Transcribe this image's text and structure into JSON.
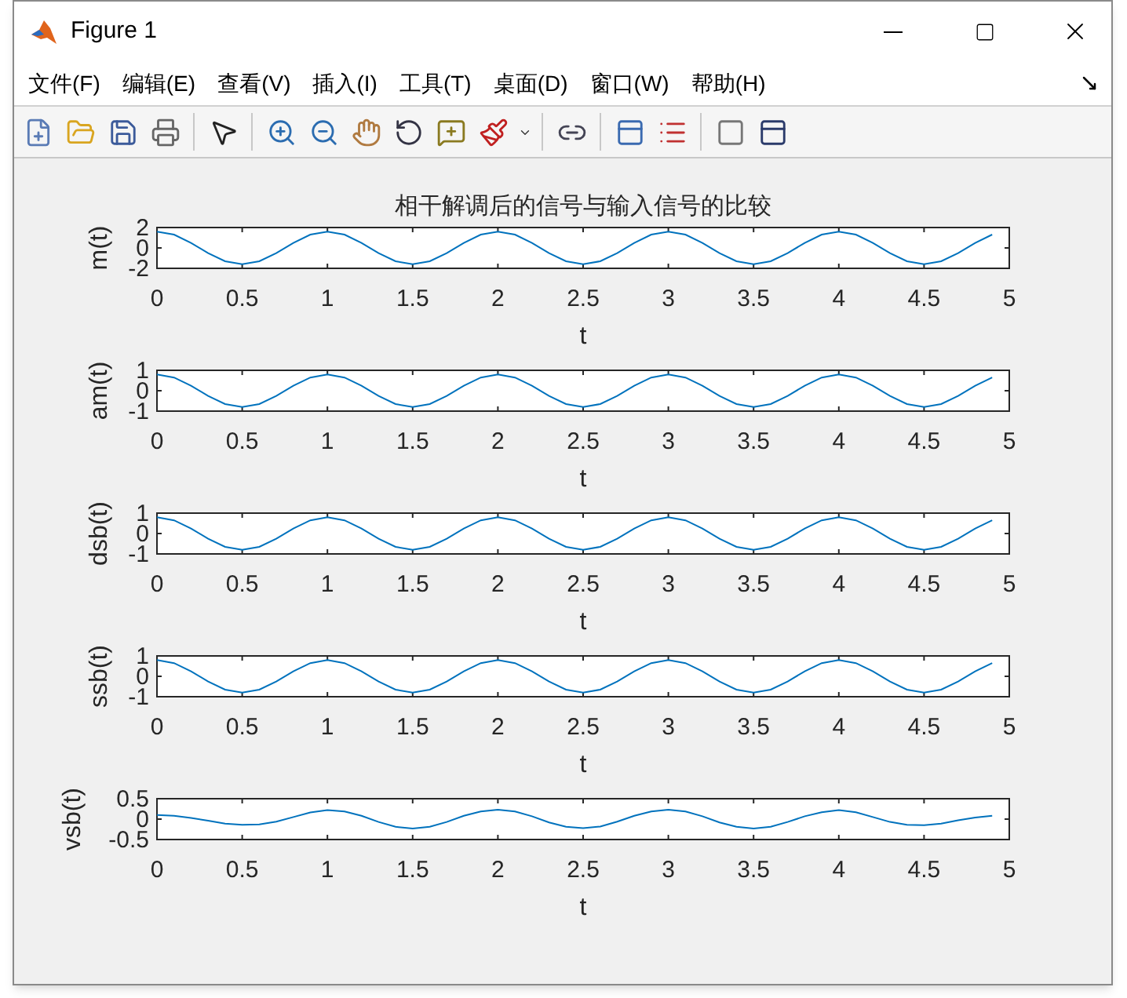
{
  "window": {
    "title": "Figure 1"
  },
  "menu": [
    "文件(F)",
    "编辑(E)",
    "查看(V)",
    "插入(I)",
    "工具(T)",
    "桌面(D)",
    "窗口(W)",
    "帮助(H)"
  ],
  "subplots": [
    {
      "chart_data": {
        "type": "line",
        "title": "相干解调后的信号与输入信号的比较",
        "xlabel": "t",
        "ylabel": "m(t)",
        "x": [
          0,
          0.1,
          0.2,
          0.3,
          0.4,
          0.5,
          0.6,
          0.7,
          0.8,
          0.9,
          1,
          1.1,
          1.2,
          1.3,
          1.4,
          1.5,
          1.6,
          1.7,
          1.8,
          1.9,
          2,
          2.1,
          2.2,
          2.3,
          2.4,
          2.5,
          2.6,
          2.7,
          2.8,
          2.9,
          3,
          3.1,
          3.2,
          3.3,
          3.4,
          3.5,
          3.6,
          3.7,
          3.8,
          3.9,
          4,
          4.1,
          4.2,
          4.3,
          4.4,
          4.5,
          4.6,
          4.7,
          4.8,
          4.9
        ],
        "series": [
          {
            "color": "#0072bd",
            "values": [
              1.6,
              1.3,
              0.5,
              -0.5,
              -1.3,
              -1.6,
              -1.3,
              -0.5,
              0.5,
              1.3,
              1.6,
              1.3,
              0.5,
              -0.5,
              -1.3,
              -1.6,
              -1.3,
              -0.5,
              0.5,
              1.3,
              1.6,
              1.3,
              0.5,
              -0.5,
              -1.3,
              -1.6,
              -1.3,
              -0.5,
              0.5,
              1.3,
              1.6,
              1.3,
              0.5,
              -0.5,
              -1.3,
              -1.6,
              -1.3,
              -0.5,
              0.5,
              1.3,
              1.6,
              1.3,
              0.5,
              -0.5,
              -1.3,
              -1.6,
              -1.3,
              -0.5,
              0.5,
              1.3
            ]
          }
        ],
        "xlim": [
          0,
          5
        ],
        "ylim": [
          -2,
          2
        ],
        "xticks": [
          0,
          0.5,
          1,
          1.5,
          2,
          2.5,
          3,
          3.5,
          4,
          4.5,
          5
        ],
        "yticks": [
          -2,
          0,
          2
        ]
      }
    },
    {
      "chart_data": {
        "type": "line",
        "xlabel": "t",
        "ylabel": "am(t)",
        "x": [
          0,
          0.1,
          0.2,
          0.3,
          0.4,
          0.5,
          0.6,
          0.7,
          0.8,
          0.9,
          1,
          1.1,
          1.2,
          1.3,
          1.4,
          1.5,
          1.6,
          1.7,
          1.8,
          1.9,
          2,
          2.1,
          2.2,
          2.3,
          2.4,
          2.5,
          2.6,
          2.7,
          2.8,
          2.9,
          3,
          3.1,
          3.2,
          3.3,
          3.4,
          3.5,
          3.6,
          3.7,
          3.8,
          3.9,
          4,
          4.1,
          4.2,
          4.3,
          4.4,
          4.5,
          4.6,
          4.7,
          4.8,
          4.9
        ],
        "series": [
          {
            "color": "#0072bd",
            "values": [
              0.8,
              0.65,
              0.25,
              -0.25,
              -0.65,
              -0.8,
              -0.65,
              -0.25,
              0.25,
              0.65,
              0.8,
              0.65,
              0.25,
              -0.25,
              -0.65,
              -0.8,
              -0.65,
              -0.25,
              0.25,
              0.65,
              0.8,
              0.65,
              0.25,
              -0.25,
              -0.65,
              -0.8,
              -0.65,
              -0.25,
              0.25,
              0.65,
              0.8,
              0.65,
              0.25,
              -0.25,
              -0.65,
              -0.8,
              -0.65,
              -0.25,
              0.25,
              0.65,
              0.8,
              0.65,
              0.25,
              -0.25,
              -0.65,
              -0.8,
              -0.65,
              -0.25,
              0.25,
              0.65
            ]
          }
        ],
        "xlim": [
          0,
          5
        ],
        "ylim": [
          -1,
          1
        ],
        "xticks": [
          0,
          0.5,
          1,
          1.5,
          2,
          2.5,
          3,
          3.5,
          4,
          4.5,
          5
        ],
        "yticks": [
          -1,
          0,
          1
        ]
      }
    },
    {
      "chart_data": {
        "type": "line",
        "xlabel": "t",
        "ylabel": "dsb(t)",
        "x": [
          0,
          0.1,
          0.2,
          0.3,
          0.4,
          0.5,
          0.6,
          0.7,
          0.8,
          0.9,
          1,
          1.1,
          1.2,
          1.3,
          1.4,
          1.5,
          1.6,
          1.7,
          1.8,
          1.9,
          2,
          2.1,
          2.2,
          2.3,
          2.4,
          2.5,
          2.6,
          2.7,
          2.8,
          2.9,
          3,
          3.1,
          3.2,
          3.3,
          3.4,
          3.5,
          3.6,
          3.7,
          3.8,
          3.9,
          4,
          4.1,
          4.2,
          4.3,
          4.4,
          4.5,
          4.6,
          4.7,
          4.8,
          4.9
        ],
        "series": [
          {
            "color": "#0072bd",
            "values": [
              0.8,
              0.65,
              0.25,
              -0.25,
              -0.65,
              -0.8,
              -0.65,
              -0.25,
              0.25,
              0.65,
              0.8,
              0.65,
              0.25,
              -0.25,
              -0.65,
              -0.8,
              -0.65,
              -0.25,
              0.25,
              0.65,
              0.8,
              0.65,
              0.25,
              -0.25,
              -0.65,
              -0.8,
              -0.65,
              -0.25,
              0.25,
              0.65,
              0.8,
              0.65,
              0.25,
              -0.25,
              -0.65,
              -0.8,
              -0.65,
              -0.25,
              0.25,
              0.65,
              0.8,
              0.65,
              0.25,
              -0.25,
              -0.65,
              -0.8,
              -0.65,
              -0.25,
              0.25,
              0.65
            ]
          }
        ],
        "xlim": [
          0,
          5
        ],
        "ylim": [
          -1,
          1
        ],
        "xticks": [
          0,
          0.5,
          1,
          1.5,
          2,
          2.5,
          3,
          3.5,
          4,
          4.5,
          5
        ],
        "yticks": [
          -1,
          0,
          1
        ]
      }
    },
    {
      "chart_data": {
        "type": "line",
        "xlabel": "t",
        "ylabel": "ssb(t)",
        "x": [
          0,
          0.1,
          0.2,
          0.3,
          0.4,
          0.5,
          0.6,
          0.7,
          0.8,
          0.9,
          1,
          1.1,
          1.2,
          1.3,
          1.4,
          1.5,
          1.6,
          1.7,
          1.8,
          1.9,
          2,
          2.1,
          2.2,
          2.3,
          2.4,
          2.5,
          2.6,
          2.7,
          2.8,
          2.9,
          3,
          3.1,
          3.2,
          3.3,
          3.4,
          3.5,
          3.6,
          3.7,
          3.8,
          3.9,
          4,
          4.1,
          4.2,
          4.3,
          4.4,
          4.5,
          4.6,
          4.7,
          4.8,
          4.9
        ],
        "series": [
          {
            "color": "#0072bd",
            "values": [
              0.8,
              0.65,
              0.25,
              -0.25,
              -0.65,
              -0.8,
              -0.65,
              -0.25,
              0.25,
              0.65,
              0.8,
              0.65,
              0.25,
              -0.25,
              -0.65,
              -0.8,
              -0.65,
              -0.25,
              0.25,
              0.65,
              0.8,
              0.65,
              0.25,
              -0.25,
              -0.65,
              -0.8,
              -0.65,
              -0.25,
              0.25,
              0.65,
              0.8,
              0.65,
              0.25,
              -0.25,
              -0.65,
              -0.8,
              -0.65,
              -0.25,
              0.25,
              0.65,
              0.8,
              0.65,
              0.25,
              -0.25,
              -0.65,
              -0.8,
              -0.65,
              -0.25,
              0.25,
              0.65
            ]
          }
        ],
        "xlim": [
          0,
          5
        ],
        "ylim": [
          -1,
          1
        ],
        "xticks": [
          0,
          0.5,
          1,
          1.5,
          2,
          2.5,
          3,
          3.5,
          4,
          4.5,
          5
        ],
        "yticks": [
          -1,
          0,
          1
        ]
      }
    },
    {
      "chart_data": {
        "type": "line",
        "xlabel": "t",
        "ylabel": "vsb(t)",
        "x": [
          0,
          0.1,
          0.2,
          0.3,
          0.4,
          0.5,
          0.6,
          0.7,
          0.8,
          0.9,
          1,
          1.1,
          1.2,
          1.3,
          1.4,
          1.5,
          1.6,
          1.7,
          1.8,
          1.9,
          2,
          2.1,
          2.2,
          2.3,
          2.4,
          2.5,
          2.6,
          2.7,
          2.8,
          2.9,
          3,
          3.1,
          3.2,
          3.3,
          3.4,
          3.5,
          3.6,
          3.7,
          3.8,
          3.9,
          4,
          4.1,
          4.2,
          4.3,
          4.4,
          4.5,
          4.6,
          4.7,
          4.8,
          4.9
        ],
        "series": [
          {
            "color": "#0072bd",
            "values": [
              0.1,
              0.08,
              0.03,
              -0.04,
              -0.11,
              -0.14,
              -0.13,
              -0.06,
              0.05,
              0.16,
              0.22,
              0.19,
              0.08,
              -0.07,
              -0.19,
              -0.23,
              -0.19,
              -0.07,
              0.08,
              0.19,
              0.23,
              0.19,
              0.07,
              -0.08,
              -0.19,
              -0.22,
              -0.18,
              -0.06,
              0.08,
              0.19,
              0.23,
              0.19,
              0.07,
              -0.08,
              -0.19,
              -0.23,
              -0.19,
              -0.07,
              0.07,
              0.17,
              0.22,
              0.17,
              0.05,
              -0.07,
              -0.14,
              -0.15,
              -0.11,
              -0.03,
              0.04,
              0.08
            ]
          }
        ],
        "xlim": [
          0,
          5
        ],
        "ylim": [
          -0.5,
          0.5
        ],
        "xticks": [
          0,
          0.5,
          1,
          1.5,
          2,
          2.5,
          3,
          3.5,
          4,
          4.5,
          5
        ],
        "yticks": [
          -0.5,
          0,
          0.5
        ]
      }
    }
  ]
}
